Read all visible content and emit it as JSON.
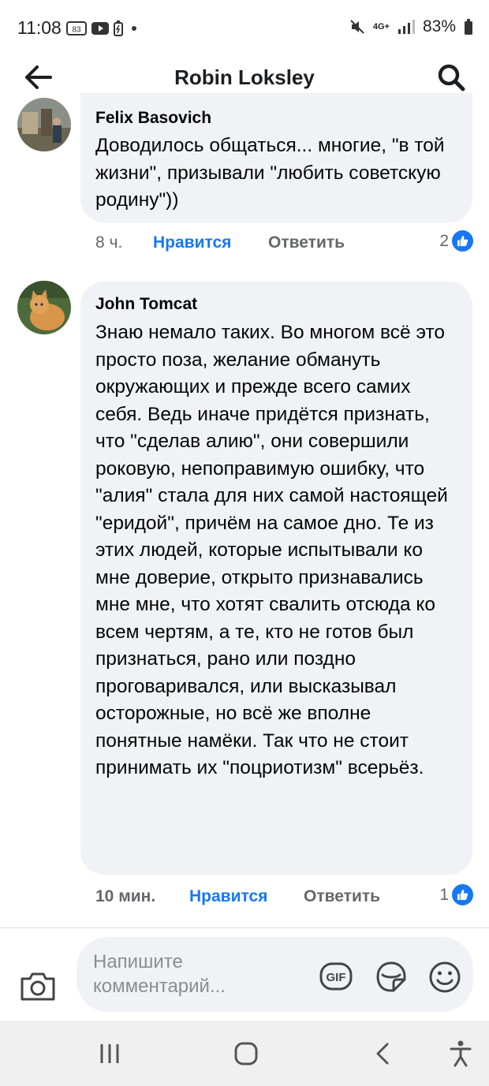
{
  "status_bar": {
    "time": "11:08",
    "notif_badge": "83",
    "network": "4G+",
    "battery": "83%"
  },
  "header": {
    "title": "Robin Loksley",
    "back_icon": "arrow-left-icon",
    "search_icon": "search-icon"
  },
  "comments": [
    {
      "author": "Felix Basovich",
      "text": "Доводилось общаться... многие, \"в той жизни\", призывали \"любить советскую родину\"))",
      "time": "8 ч.",
      "like_label": "Нравится",
      "reply_label": "Ответить",
      "reactions": "2"
    },
    {
      "author": "John Tomcat",
      "text": "Знаю немало таких. Во многом всё это просто поза, желание обмануть окружающих и прежде всего самих себя. Ведь иначе придётся признать, что \"сделав алию\", они совершили роковую, непоправимую ошибку, что \"алия\" стала для них самой настоящей \"еридой\", причём на самое дно. Те из этих людей, которые испытывали ко мне доверие, открыто признавались мне мне, что хотят свалить отсюда ко всем чертям, а те, кто не готов был признаться, рано или поздно проговаривался, или высказывал осторожные, но всё же вполне понятные намёки. Так что не стоит принимать их \"поцриотизм\" всерьёз.",
      "time": "10 мин.",
      "like_label": "Нравится",
      "reply_label": "Ответить",
      "reactions": "1"
    }
  ],
  "composer": {
    "placeholder": "Напишите комментарий...",
    "gif_label": "GIF",
    "icons": [
      "camera-icon",
      "gif-icon",
      "sticker-icon",
      "emoji-icon"
    ]
  },
  "nav_bar": {
    "icons": [
      "recent-apps-icon",
      "home-icon",
      "back-icon",
      "accessibility-icon"
    ]
  },
  "colors": {
    "accent": "#1877f2",
    "bubble": "#f0f2f5",
    "secondary_text": "#65676b"
  }
}
